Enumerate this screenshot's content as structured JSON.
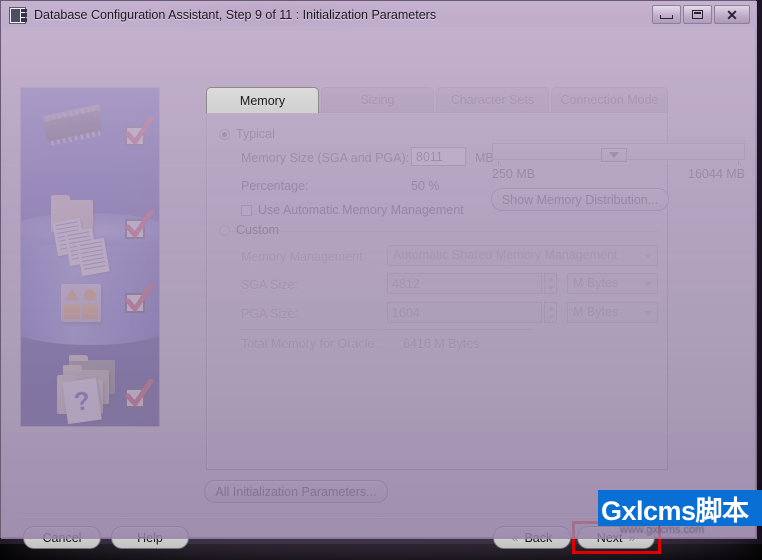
{
  "window": {
    "title": "Database Configuration Assistant, Step 9 of 11 : Initialization Parameters",
    "app_icon": "database-icon",
    "minimize_label": "Minimize",
    "maximize_label": "Maximize",
    "close_label": "Close"
  },
  "tabs": [
    {
      "label": "Memory",
      "active": true
    },
    {
      "label": "Sizing",
      "active": false
    },
    {
      "label": "Character Sets",
      "active": false
    },
    {
      "label": "Connection Mode",
      "active": false
    }
  ],
  "memory": {
    "typical": {
      "radio_label": "Typical",
      "selected": true,
      "memory_size_label": "Memory Size (SGA and PGA):",
      "memory_size_value": "8011",
      "memory_size_unit": "MB",
      "percentage_label": "Percentage:",
      "percentage_value": "50 %",
      "auto_memory_checkbox_label": "Use Automatic Memory Management",
      "auto_memory_checked": false,
      "slider_min_label": "250 MB",
      "slider_max_label": "16044 MB",
      "slider_position_percent": 43,
      "show_distribution_button": "Show Memory Distribution..."
    },
    "custom": {
      "radio_label": "Custom",
      "selected": false,
      "memory_management_label": "Memory Management",
      "memory_management_value": "Automatic Shared Memory Management",
      "sga_size_label": "SGA Size:",
      "sga_size_value": "4812",
      "sga_size_unit": "M Bytes",
      "pga_size_label": "PGA Size:",
      "pga_size_value": "1604",
      "pga_size_unit": "M Bytes",
      "total_memory_label": "Total Memory for Oracle:",
      "total_memory_value": "6416 M Bytes"
    }
  },
  "buttons": {
    "all_init_params": "All Initialization Parameters...",
    "cancel": "Cancel",
    "help": "Help",
    "back": "Back",
    "next": "Next"
  },
  "sidebar": {
    "alt": "Oracle database configuration artwork",
    "question_mark": "?",
    "checkmarks": 4
  },
  "watermark": {
    "text": "Gxlcms脚本",
    "subtext": "www.gxlcms.com"
  },
  "colors": {
    "panel": "#d4d4d4",
    "title_gradient_top": "#c9b6d4",
    "accent_blue": "#0a6fd4",
    "highlight_red": "#e00000",
    "sidebar_blue": "#1426a8"
  }
}
